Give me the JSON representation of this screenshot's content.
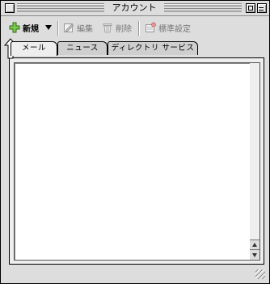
{
  "window": {
    "title": "アカウント"
  },
  "toolbar": {
    "new_label": "新規",
    "edit_label": "編集",
    "delete_label": "削除",
    "default_label": "標準設定"
  },
  "tabs": [
    {
      "label": "メール",
      "active": true
    },
    {
      "label": "ニュース",
      "active": false
    },
    {
      "label": "ディレクトリ サービス",
      "active": false
    }
  ],
  "icons": {
    "new": "plus-icon",
    "dropdown": "triangle-down-icon",
    "edit": "edit-icon",
    "delete": "trash-icon",
    "default": "default-settings-icon"
  },
  "colors": {
    "new_icon": "#4fa62d",
    "background": "#dddddd",
    "pane": "#eeeeee"
  }
}
